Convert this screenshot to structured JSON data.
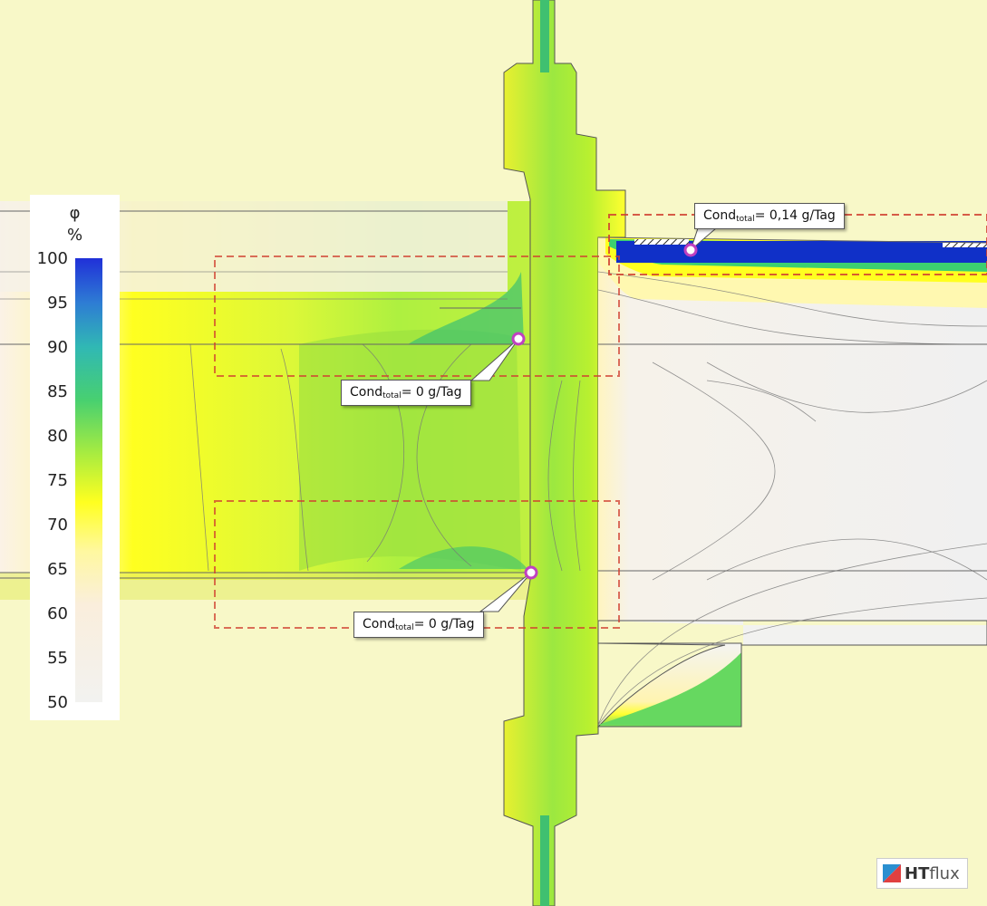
{
  "legend": {
    "symbol": "φ",
    "unit": "%",
    "ticks": [
      "100",
      "95",
      "90",
      "85",
      "80",
      "75",
      "70",
      "65",
      "60",
      "55",
      "50"
    ],
    "colors": [
      "#1a2fd0",
      "#3a70d0",
      "#30b0b0",
      "#40c880",
      "#80e040",
      "#c8f030",
      "#ffff10",
      "#fff080",
      "#fbeed8",
      "#f2f2f0"
    ]
  },
  "callouts": [
    {
      "prefix": "Cond",
      "sub": "total",
      "value": "= 0,14 g/Tag"
    },
    {
      "prefix": "Cond",
      "sub": "total",
      "value": "= 0 g/Tag"
    },
    {
      "prefix": "Cond",
      "sub": "total",
      "value": "= 0 g/Tag"
    }
  ],
  "logo": {
    "strong": "HT",
    "light": "flux"
  },
  "colors": {
    "background": "#f8f8c8",
    "detail_box": "#d04030",
    "condensation_blue": "#1030c8"
  }
}
